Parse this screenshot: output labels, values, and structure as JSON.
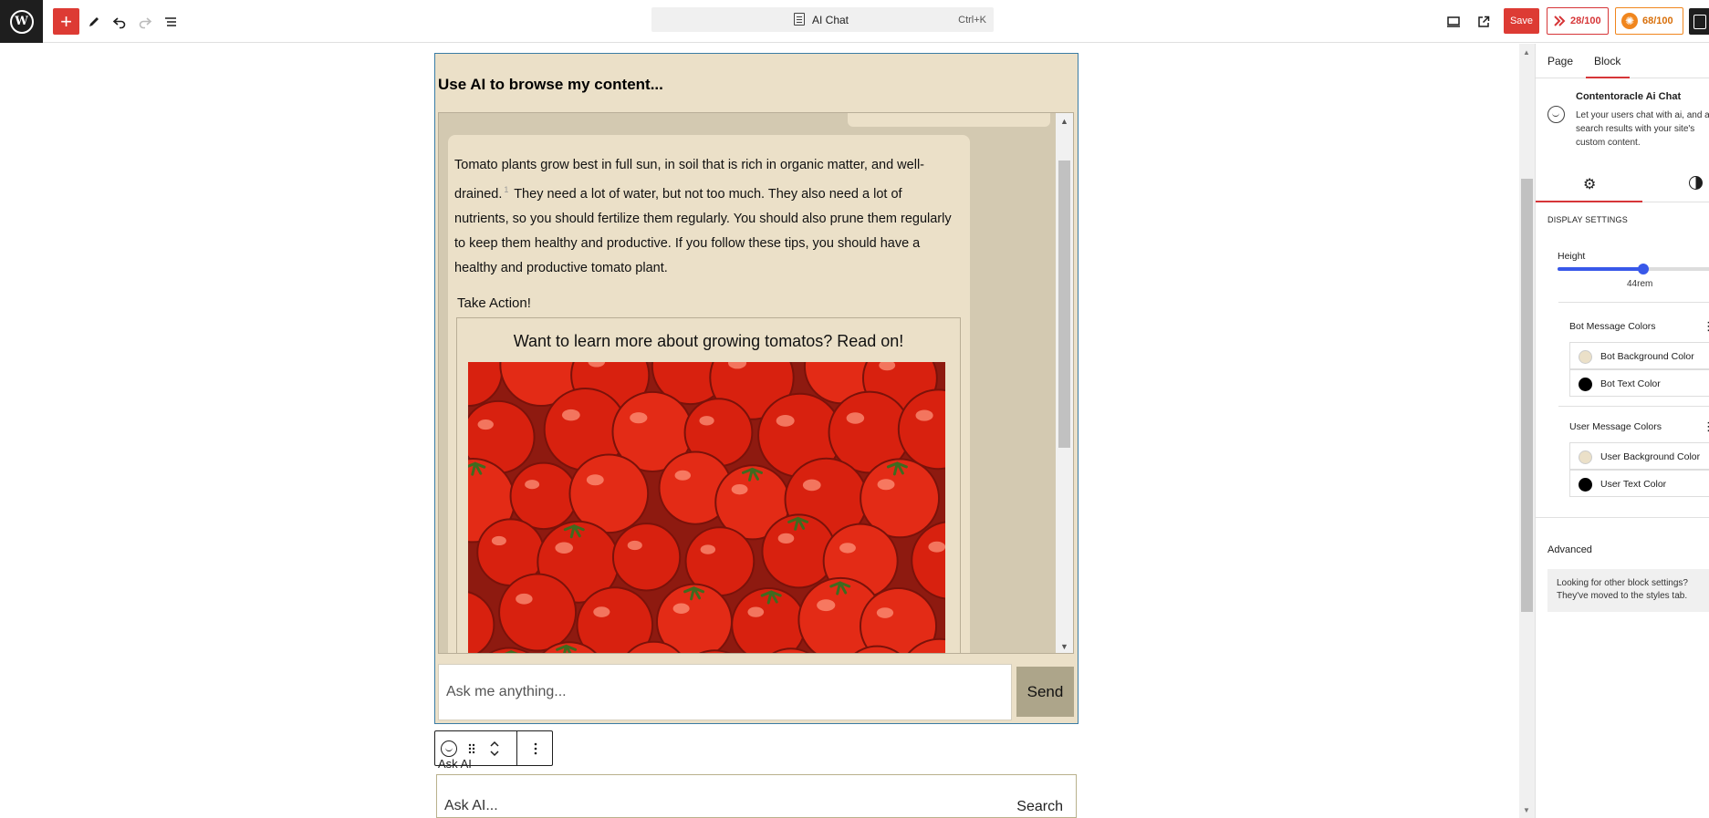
{
  "toolbar": {
    "command_title": "AI Chat",
    "command_shortcut": "Ctrl+K",
    "save_label": "Save",
    "seo_score": "28/100",
    "readability_score": "68/100"
  },
  "chat": {
    "heading": "Use AI to browse my content...",
    "bot_message_part1": "Tomato plants grow best in full sun, in soil that is rich in organic matter, and well-drained.",
    "bot_message_citation": "1",
    "bot_message_part2": "They need a lot of water, but not too much. They also need a lot of nutrients, so you should fertilize them regularly. You should also prune them regularly to keep them healthy and productive. If you follow these tips, you should have a healthy and productive tomato plant.",
    "take_action_label": "Take Action!",
    "action_card_title": "Want to learn more about growing tomatos? Read on!",
    "input_placeholder": "Ask me anything...",
    "send_label": "Send"
  },
  "ask_block": {
    "label": "Ask AI",
    "placeholder": "Ask AI...",
    "search_label": "Search"
  },
  "panel": {
    "tabs": [
      "Page",
      "Block"
    ],
    "active_tab": "Block",
    "block_title": "Contentoracle Ai Chat",
    "block_description": "Let your users chat with ai, and ai search results with your site's custom content.",
    "section_label": "Display Settings",
    "height_label": "Height",
    "height_value": "44rem",
    "height_fraction": 0.55,
    "bot_group_title": "Bot Message Colors",
    "bot_background_label": "Bot Background Color",
    "bot_text_label": "Bot Text Color",
    "user_group_title": "User Message Colors",
    "user_background_label": "User Background Color",
    "user_text_label": "User Text Color",
    "advanced_label": "Advanced",
    "moved_notice": "Looking for other block settings? They've moved to the styles tab."
  },
  "colors": {
    "accent": "#dd3b34",
    "bot_background": "#ebe0c8",
    "bot_text": "#000000",
    "user_background": "#ebe0c8",
    "user_text": "#000000",
    "send_button": "#ada58a"
  },
  "icons": {
    "logo": "wordpress-logo-icon",
    "add": "plus-icon",
    "tools": "pencil-icon",
    "undo": "undo-icon",
    "redo": "redo-icon",
    "list_view": "list-view-icon",
    "document": "document-icon",
    "preview": "desktop-icon",
    "view_page": "external-link-icon",
    "settings": "gear-icon",
    "styles": "half-circle-icon"
  }
}
